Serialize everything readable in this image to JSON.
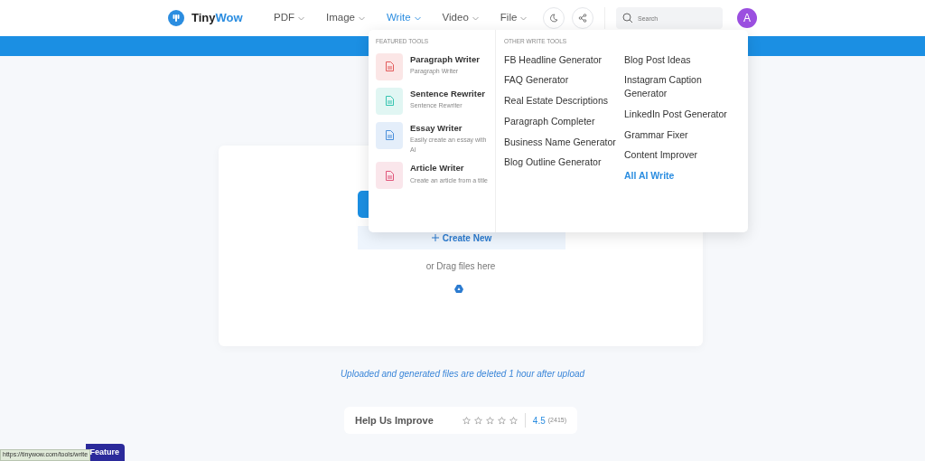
{
  "logo": {
    "first": "Tiny",
    "second": "Wow"
  },
  "nav": [
    {
      "label": "PDF",
      "selected": false
    },
    {
      "label": "Image",
      "selected": false
    },
    {
      "label": "Write",
      "selected": true
    },
    {
      "label": "Video",
      "selected": false
    },
    {
      "label": "File",
      "selected": false
    }
  ],
  "search": {
    "placeholder": "Search"
  },
  "avatar": "A",
  "menu": {
    "featured_heading": "FEATURED TOOLS",
    "featured": [
      {
        "title": "Paragraph Writer",
        "subtitle": "Paragraph Writer",
        "color": "#e25a5a"
      },
      {
        "title": "Sentence Rewriter",
        "subtitle": "Sentence Rewriter",
        "color": "#35c4b0"
      },
      {
        "title": "Essay Writer",
        "subtitle": "Easily create an essay with AI",
        "color": "#4a8fdb"
      },
      {
        "title": "Article Writer",
        "subtitle": "Create an article from a title",
        "color": "#e0557a"
      }
    ],
    "other_heading": "OTHER WRITE TOOLS",
    "other_columns": [
      [
        {
          "label": "FB Headline Generator",
          "kind": "tool"
        },
        {
          "label": "FAQ Generator",
          "kind": "tool"
        },
        {
          "label": "Real Estate Descriptions",
          "kind": "tool"
        },
        {
          "label": "Paragraph Completer",
          "kind": "tool"
        },
        {
          "label": "Business Name Generator",
          "kind": "tool"
        },
        {
          "label": "Blog Outline Generator",
          "kind": "tool"
        }
      ],
      [
        {
          "label": "Blog Post Ideas",
          "kind": "tool"
        },
        {
          "label": "Instagram Caption Generator",
          "kind": "tool"
        },
        {
          "label": "LinkedIn Post Generator",
          "kind": "tool"
        },
        {
          "label": "Grammar Fixer",
          "kind": "tool"
        },
        {
          "label": "Content Improver",
          "kind": "tool"
        },
        {
          "label": "All AI Write",
          "kind": "all"
        }
      ]
    ]
  },
  "upload": {
    "create_new": "Create New",
    "drag_text": "or Drag files here"
  },
  "notice": "Uploaded and generated files are deleted 1 hour after upload",
  "feedback": {
    "title": "Help Us Improve",
    "stars": 0,
    "rating": "4.5",
    "count": "(2415)"
  },
  "feature_button": "Feature",
  "status_url": "https://tinywow.com/tools/write"
}
